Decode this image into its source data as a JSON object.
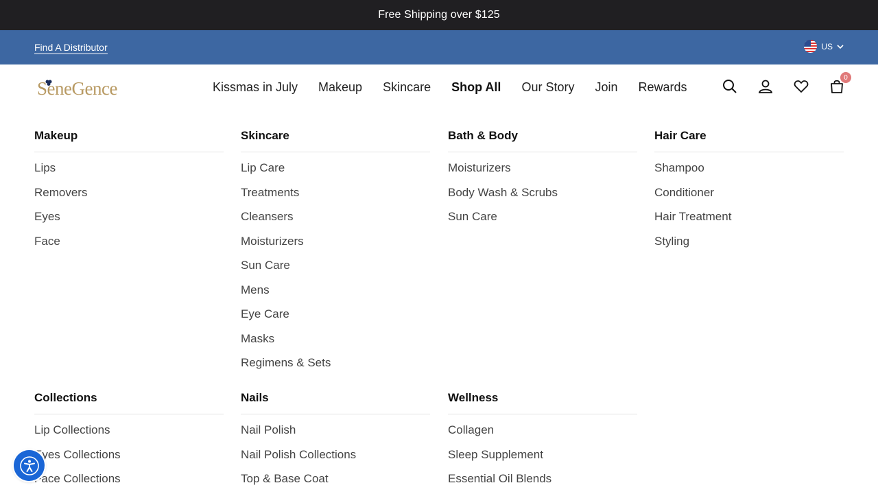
{
  "announcement": "Free Shipping over $125",
  "utility": {
    "distributor_link": "Find A Distributor",
    "locale": "US"
  },
  "logo_text": "SeneGence",
  "nav": [
    "Kissmas in July",
    "Makeup",
    "Skincare",
    "Shop All",
    "Our Story",
    "Join",
    "Rewards"
  ],
  "cart_count": "0",
  "colors": {
    "announcement_bg": "#201f22",
    "utility_bg": "#3d67a2",
    "logo_gold": "#b89a63",
    "badge": "#e07a7a",
    "accessibility": "#1a66d6"
  },
  "menu": {
    "makeup": {
      "title": "Makeup",
      "items": [
        "Lips",
        "Removers",
        "Eyes",
        "Face"
      ]
    },
    "skincare": {
      "title": "Skincare",
      "items": [
        "Lip Care",
        "Treatments",
        "Cleansers",
        "Moisturizers",
        "Sun Care",
        "Mens",
        "Eye Care",
        "Masks",
        "Regimens & Sets"
      ]
    },
    "bath": {
      "title": "Bath & Body",
      "items": [
        "Moisturizers",
        "Body Wash & Scrubs",
        "Sun Care"
      ]
    },
    "hair": {
      "title": "Hair Care",
      "items": [
        "Shampoo",
        "Conditioner",
        "Hair Treatment",
        "Styling"
      ]
    },
    "collections": {
      "title": "Collections",
      "items": [
        "Lip Collections",
        "Eyes Collections",
        "Face Collections"
      ]
    },
    "nails": {
      "title": "Nails",
      "items": [
        "Nail Polish",
        "Nail Polish Collections",
        "Top & Base Coat"
      ]
    },
    "wellness": {
      "title": "Wellness",
      "items": [
        "Collagen",
        "Sleep Supplement",
        "Essential Oil Blends"
      ]
    }
  },
  "icons": [
    "search-icon",
    "account-icon",
    "heart-icon",
    "cart-icon",
    "chevron-down-icon",
    "accessibility-icon"
  ]
}
